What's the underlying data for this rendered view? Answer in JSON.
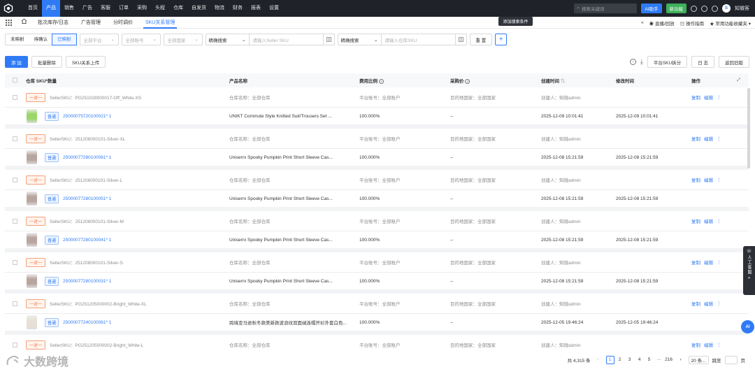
{
  "topnav": {
    "menu": [
      "首页",
      "产品",
      "销售",
      "广告",
      "客服",
      "订单",
      "采购",
      "头程",
      "仓库",
      "自发货",
      "物流",
      "财务",
      "报表",
      "设置"
    ],
    "active_index": 1,
    "search_placeholder": "搜索关键词",
    "ai_label": "AI助手",
    "new_label": "新功能",
    "user_initial": "S",
    "user_name": "知微客"
  },
  "tabbar": {
    "tabs": [
      "批次库存/日志",
      "广告管理",
      "分时调价",
      "SKU关系管理"
    ],
    "active_index": 3,
    "right_links": [
      "直播/回放",
      "操作指南",
      "常用功能收藏夹"
    ],
    "tooltip": "添加搜索条件"
  },
  "filters": {
    "segments": [
      "未映射",
      "待确认",
      "已映射"
    ],
    "active_segment": 2,
    "platform_placeholder": "全部平台",
    "account_placeholder": "全部账号",
    "country_placeholder": "全部国家",
    "combo1_key": "精确搜索",
    "combo1_placeholder": "请输入Seller SKU",
    "combo2_key": "精确搜索",
    "combo2_placeholder": "请输入仓库SKU",
    "reset_label": "重 置",
    "add_label": "+"
  },
  "actions": {
    "add_label": "添 加",
    "batch_delete_label": "批量删除",
    "upload_label": "SKU关系上传",
    "split_label": "平台SKU拆分",
    "log_label": "日 志",
    "old_version_label": "返回旧版"
  },
  "columns": {
    "sku_qty": "仓库 SKU*数量",
    "product_name": "产品名称",
    "cost_ratio": "费用比例",
    "purchase_price": "采购价",
    "created_at": "创建时间",
    "modified_at": "修改时间",
    "ops": "操作"
  },
  "rows": [
    {
      "tag": "一对一",
      "seller_sku": "SellerSKU：PG251028000017-Off_White-XS",
      "warehouse": "仓库名称：全部仓库",
      "account": "平台账号：全部账户",
      "country": "目的地国家：全部国家",
      "creator": "创建人：知微admin",
      "child_tag": "普通",
      "child_sku": "25000075720100021* 1",
      "product": "UNIKT Commute Style Knitted Suit/Trousers Set ...",
      "ratio": "100.000%",
      "price": "--",
      "created": "2025-12-09 10:01:41",
      "modified": "2025-12-09 10:01:41",
      "thumb": "#9bd66a"
    },
    {
      "tag": "一对一",
      "seller_sku": "SellerSKU：251208000101-Silver-XL",
      "warehouse": "仓库名称：全部仓库",
      "account": "平台账号：全部账户",
      "country": "目的地国家：全部国家",
      "creator": "创建人：知微admin",
      "child_tag": "普通",
      "child_sku": "25000077280100061* 1",
      "product": "Uniserrx Spooky Pumpkin Print Short Sleeve Cas...",
      "ratio": "100.000%",
      "price": "--",
      "created": "2025-12-08 15:21:59",
      "modified": "2025-12-08 15:21:59",
      "thumb": "#b9a5a0"
    },
    {
      "tag": "一对一",
      "seller_sku": "SellerSKU：251208000101-Silver-L",
      "warehouse": "仓库名称：全部仓库",
      "account": "平台账号：全部账户",
      "country": "目的地国家：全部国家",
      "creator": "创建人：知微admin",
      "child_tag": "普通",
      "child_sku": "25000077280100051* 1",
      "product": "Uniserrx Spooky Pumpkin Print Short Sleeve Cas...",
      "ratio": "100.000%",
      "price": "--",
      "created": "2025-12-08 15:21:59",
      "modified": "2025-12-08 15:21:59",
      "thumb": "#b9a5a0"
    },
    {
      "tag": "一对一",
      "seller_sku": "SellerSKU：251208000101-Silver-M",
      "warehouse": "仓库名称：全部仓库",
      "account": "平台账号：全部账户",
      "country": "目的地国家：全部国家",
      "creator": "创建人：知微admin",
      "child_tag": "普通",
      "child_sku": "25000077280100041* 1",
      "product": "Uniserrx Spooky Pumpkin Print Short Sleeve Cas...",
      "ratio": "100.000%",
      "price": "--",
      "created": "2025-12-08 15:21:59",
      "modified": "2025-12-08 15:21:59",
      "thumb": "#b9a5a0"
    },
    {
      "tag": "一对一",
      "seller_sku": "SellerSKU：251208000101-Silver-S",
      "warehouse": "仓库名称：全部仓库",
      "account": "平台账号：全部账户",
      "country": "目的地国家：全部国家",
      "creator": "创建人：知微admin",
      "child_tag": "普通",
      "child_sku": "25000077280100031* 1",
      "product": "Uniserrx Spooky Pumpkin Print Short Sleeve Cas...",
      "ratio": "100.000%",
      "price": "--",
      "created": "2025-12-08 15:21:59",
      "modified": "2025-12-08 15:21:59",
      "thumb": "#b9a5a0"
    },
    {
      "tag": "一对一",
      "seller_sku": "SellerSKU：PG251205000002-Bright_White-XL",
      "warehouse": "仓库名称：全部仓库",
      "account": "平台账号：全部账户",
      "country": "目的地国家：全部国家",
      "creator": "创建人：知微admin",
      "child_tag": "普通",
      "child_sku": "25000077240100061* 1",
      "product": "跨境亚马逊秋冬款美新款波浪纹双面绒连帽开衫外套白色...",
      "ratio": "100.000%",
      "price": "--",
      "created": "2025-12-05 19:46:24",
      "modified": "2025-12-05 19:46:24",
      "thumb": "#e8e0d4"
    },
    {
      "tag": "一对一",
      "seller_sku": "SellerSKU：PG251205000002-Bright_White-L",
      "warehouse": "仓库名称：全部仓库",
      "account": "平台账号：全部账户",
      "country": "目的地国家：全部国家",
      "creator": "创建人：知微admin",
      "child_tag": "",
      "child_sku": "",
      "product": "",
      "ratio": "",
      "price": "",
      "created": "",
      "modified": "",
      "thumb": ""
    }
  ],
  "row_links": {
    "copy": "复制",
    "edit": "编辑",
    "more": "⋮"
  },
  "pager": {
    "total": "共 4,315 条",
    "pages": [
      "1",
      "2",
      "3",
      "4",
      "5",
      "···",
      "216"
    ],
    "current": "1",
    "size": "20 条...",
    "goto_label": "跳至",
    "page_suffix": "页"
  },
  "side_widget": {
    "label": "人工客服"
  },
  "ai_float": "AI",
  "watermark": "大数跨境",
  "colors": {
    "accent": "#2f7bf6",
    "nav_bg": "#1f2229",
    "tag_orange": "#f0703c"
  }
}
